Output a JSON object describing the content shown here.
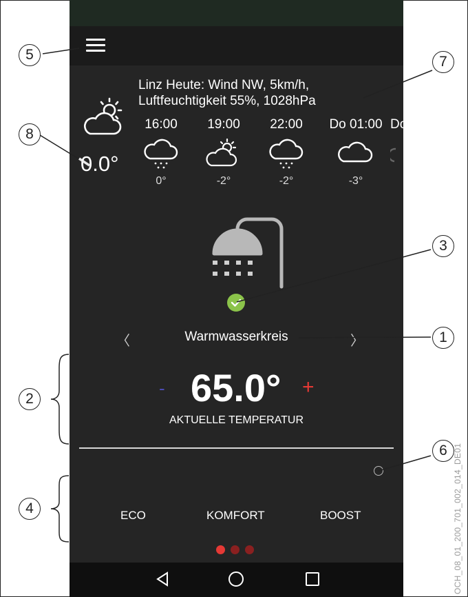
{
  "weather": {
    "description_line1": "Linz Heute: Wind NW, 5km/h,",
    "description_line2": "Luftfeuchtigkeit 55%, 1028hPa",
    "current_temperature": "0.0°",
    "forecast": [
      {
        "time": "16:00",
        "icon": "snow-cloud-icon",
        "temp": "0°"
      },
      {
        "time": "19:00",
        "icon": "partly-cloudy-icon",
        "temp": "-2°"
      },
      {
        "time": "22:00",
        "icon": "snow-cloud-icon",
        "temp": "-2°"
      },
      {
        "time": "Do 01:00",
        "icon": "cloud-icon",
        "temp": "-3°"
      },
      {
        "time": "Do",
        "icon": "cloud-icon",
        "temp": ""
      }
    ]
  },
  "circuit": {
    "name": "Warmwasserkreis",
    "prev_arrow": "〈",
    "next_arrow": "〉"
  },
  "temperature": {
    "minus": "-",
    "value": "65.0°",
    "plus": "+",
    "label": "AKTUELLE TEMPERATUR"
  },
  "modes": [
    "ECO",
    "KOMFORT",
    "BOOST"
  ],
  "pager": {
    "pages": 3,
    "active": 1
  },
  "callouts": [
    "1",
    "2",
    "3",
    "4",
    "5",
    "6",
    "7",
    "8"
  ],
  "document_code": "OCH_08_01_200_701_002_014_DE01",
  "colors": {
    "background": "#252525",
    "accent_red": "#e53935",
    "minus_blue": "#4c4cb4",
    "check_green": "#8bc34a"
  }
}
